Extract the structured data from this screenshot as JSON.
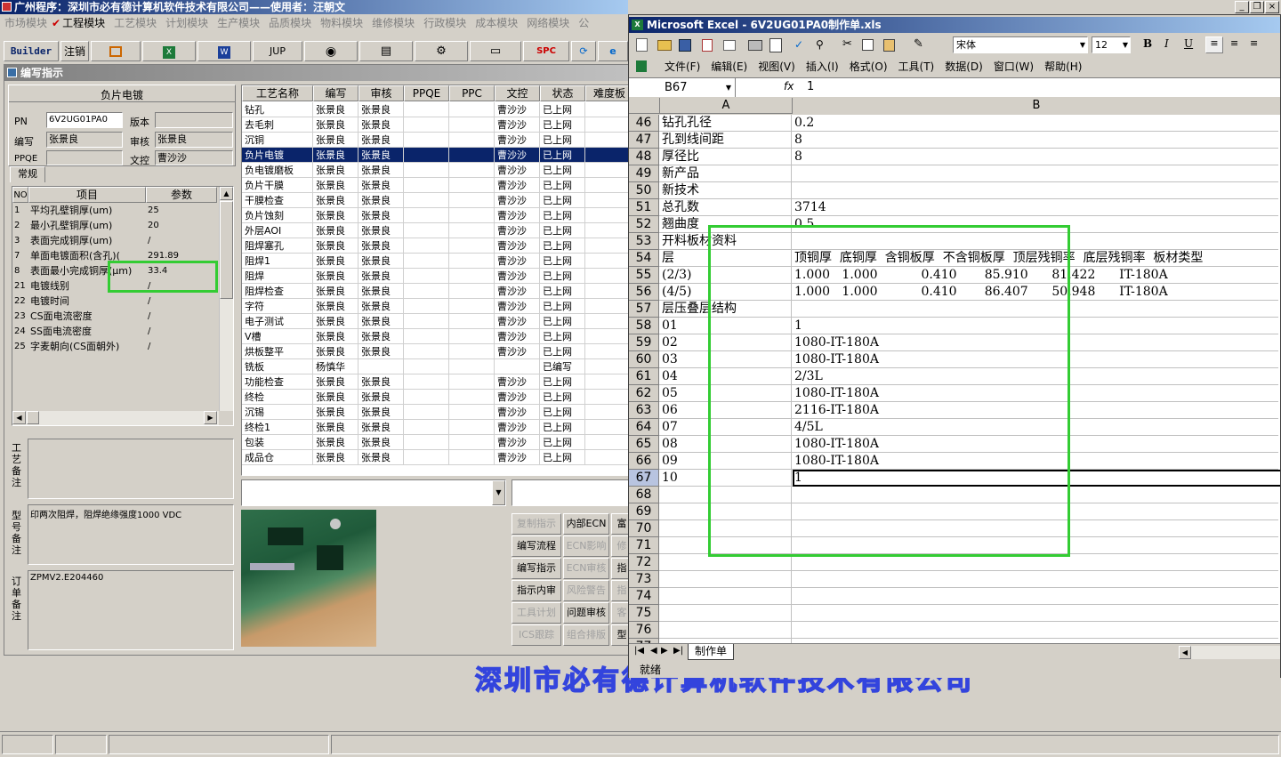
{
  "app": {
    "title": "广州程序：深圳市必有德计算机软件技术有限公司——使用者：汪朝文"
  },
  "menu": [
    "市场模块",
    "工程模块",
    "工艺模块",
    "计划模块",
    "生产模块",
    "品质模块",
    "物料模块",
    "维修模块",
    "行政模块",
    "成本模块",
    "网络模块",
    "公"
  ],
  "toolbar": {
    "builder": "Builder",
    "logout": "注销",
    "jup": "JUP",
    "spc": "SPC"
  },
  "panel": {
    "title": "编写指示",
    "section_title": "负片电镀",
    "pn_label": "PN",
    "pn_value": "6V2UG01PA0",
    "version_label": "版本",
    "version_value": "",
    "editor_label": "编写",
    "editor_value": "张景良",
    "reviewer_label": "审核",
    "reviewer_value": "张景良",
    "ppqe_label": "PPQE",
    "ppqe_value": "",
    "control_label": "文控",
    "control_value": "曹沙沙",
    "tab_general": "常规",
    "param_headers": [
      "NO",
      "项目",
      "参数"
    ],
    "params": [
      {
        "no": "1",
        "item": "平均孔壁铜厚(um)",
        "value": "25"
      },
      {
        "no": "2",
        "item": "最小孔壁铜厚(um)",
        "value": "20"
      },
      {
        "no": "3",
        "item": "表面完成铜厚(um)",
        "value": "/"
      },
      {
        "no": "7",
        "item": "单面电镀面积(含孔)(",
        "value": "291.89"
      },
      {
        "no": "8",
        "item": "表面最小完成铜厚(μm)",
        "value": "33.4"
      },
      {
        "no": "21",
        "item": "电镀线别",
        "value": "/"
      },
      {
        "no": "22",
        "item": "电镀时间",
        "value": "/"
      },
      {
        "no": "23",
        "item": "CS面电流密度",
        "value": "/"
      },
      {
        "no": "24",
        "item": "SS面电流密度",
        "value": "/"
      },
      {
        "no": "25",
        "item": "字麦朝向(CS面朝外)",
        "value": "/"
      }
    ],
    "craft_note_label": "工艺备注",
    "craft_note": "",
    "model_note_label": "型号备注",
    "model_note": "印两次阻焊，阻焊绝缘强度1000 VDC",
    "order_note_label": "订单备注",
    "order_note": "ZPMV2.E204460"
  },
  "process": {
    "headers": [
      "工艺名称",
      "编写",
      "审核",
      "PPQE",
      "PPC",
      "文控",
      "状态",
      "难度板"
    ],
    "rows": [
      [
        "钻孔",
        "张景良",
        "张景良",
        "",
        "",
        "曹沙沙",
        "已上网"
      ],
      [
        "去毛刺",
        "张景良",
        "张景良",
        "",
        "",
        "曹沙沙",
        "已上网"
      ],
      [
        "沉铜",
        "张景良",
        "张景良",
        "",
        "",
        "曹沙沙",
        "已上网"
      ],
      [
        "负片电镀",
        "张景良",
        "张景良",
        "",
        "",
        "曹沙沙",
        "已上网"
      ],
      [
        "负电镀磨板",
        "张景良",
        "张景良",
        "",
        "",
        "曹沙沙",
        "已上网"
      ],
      [
        "负片干膜",
        "张景良",
        "张景良",
        "",
        "",
        "曹沙沙",
        "已上网"
      ],
      [
        "干膜检查",
        "张景良",
        "张景良",
        "",
        "",
        "曹沙沙",
        "已上网"
      ],
      [
        "负片蚀刻",
        "张景良",
        "张景良",
        "",
        "",
        "曹沙沙",
        "已上网"
      ],
      [
        "外层AOI",
        "张景良",
        "张景良",
        "",
        "",
        "曹沙沙",
        "已上网"
      ],
      [
        "阻焊塞孔",
        "张景良",
        "张景良",
        "",
        "",
        "曹沙沙",
        "已上网"
      ],
      [
        "阻焊1",
        "张景良",
        "张景良",
        "",
        "",
        "曹沙沙",
        "已上网"
      ],
      [
        "阻焊",
        "张景良",
        "张景良",
        "",
        "",
        "曹沙沙",
        "已上网"
      ],
      [
        "阻焊检查",
        "张景良",
        "张景良",
        "",
        "",
        "曹沙沙",
        "已上网"
      ],
      [
        "字符",
        "张景良",
        "张景良",
        "",
        "",
        "曹沙沙",
        "已上网"
      ],
      [
        "电子测试",
        "张景良",
        "张景良",
        "",
        "",
        "曹沙沙",
        "已上网"
      ],
      [
        "V槽",
        "张景良",
        "张景良",
        "",
        "",
        "曹沙沙",
        "已上网"
      ],
      [
        "烘板整平",
        "张景良",
        "张景良",
        "",
        "",
        "曹沙沙",
        "已上网"
      ],
      [
        "铣板",
        "杨慎华",
        "",
        "",
        "",
        "",
        "已编写"
      ],
      [
        "功能检查",
        "张景良",
        "张景良",
        "",
        "",
        "曹沙沙",
        "已上网"
      ],
      [
        "终检",
        "张景良",
        "张景良",
        "",
        "",
        "曹沙沙",
        "已上网"
      ],
      [
        "沉锡",
        "张景良",
        "张景良",
        "",
        "",
        "曹沙沙",
        "已上网"
      ],
      [
        "终检1",
        "张景良",
        "张景良",
        "",
        "",
        "曹沙沙",
        "已上网"
      ],
      [
        "包装",
        "张景良",
        "张景良",
        "",
        "",
        "曹沙沙",
        "已上网"
      ],
      [
        "成品仓",
        "张景良",
        "张景良",
        "",
        "",
        "曹沙沙",
        "已上网"
      ]
    ]
  },
  "actions": [
    [
      "复制指示",
      "内部ECN",
      "富"
    ],
    [
      "编写流程",
      "ECN影响",
      "修"
    ],
    [
      "编写指示",
      "ECN审核",
      "指"
    ],
    [
      "指示内审",
      "风险警告",
      "指"
    ],
    [
      "工具计划",
      "问题审核",
      "客"
    ],
    [
      "ICS跟踪",
      "组合排版",
      "型"
    ]
  ],
  "watermark": "深圳市必有德计算机软件技术有限公司",
  "excel": {
    "title": "Microsoft Excel - 6V2UG01PA0制作单.xls",
    "font": "宋体",
    "font_size": "12",
    "menu": [
      "文件(F)",
      "编辑(E)",
      "视图(V)",
      "插入(I)",
      "格式(O)",
      "工具(T)",
      "数据(D)",
      "窗口(W)",
      "帮助(H)"
    ],
    "namebox": "B67",
    "fx": "fx",
    "formula": "1",
    "col_a": "A",
    "col_b": "B",
    "rows": [
      {
        "n": "46",
        "a": "钻孔孔径",
        "b": "0.2"
      },
      {
        "n": "47",
        "a": "孔到线间距",
        "b": "8"
      },
      {
        "n": "48",
        "a": "厚径比",
        "b": "8"
      },
      {
        "n": "49",
        "a": "新产品",
        "b": ""
      },
      {
        "n": "50",
        "a": "新技术",
        "b": ""
      },
      {
        "n": "51",
        "a": "总孔数",
        "b": "3714"
      },
      {
        "n": "52",
        "a": "翘曲度",
        "b": "0.5"
      },
      {
        "n": "53",
        "a": "开料板材资料",
        "b": ""
      },
      {
        "n": "54",
        "a": "层",
        "b": "顶铜厚  底铜厚  含铜板厚  不含铜板厚  顶层残铜率  底层残铜率  板材类型"
      },
      {
        "n": "55",
        "a": "(2/3)",
        "b": "1.000   1.000           0.410       85.910      81.422      IT-180A"
      },
      {
        "n": "56",
        "a": "(4/5)",
        "b": "1.000   1.000           0.410       86.407      50.948      IT-180A"
      },
      {
        "n": "57",
        "a": "层压叠层结构",
        "b": ""
      },
      {
        "n": "58",
        "a": "01",
        "b": "1"
      },
      {
        "n": "59",
        "a": "02",
        "b": "1080-IT-180A"
      },
      {
        "n": "60",
        "a": "03",
        "b": "1080-IT-180A"
      },
      {
        "n": "61",
        "a": "04",
        "b": "2/3L"
      },
      {
        "n": "62",
        "a": "05",
        "b": "1080-IT-180A"
      },
      {
        "n": "63",
        "a": "06",
        "b": "2116-IT-180A"
      },
      {
        "n": "64",
        "a": "07",
        "b": "4/5L"
      },
      {
        "n": "65",
        "a": "08",
        "b": "1080-IT-180A"
      },
      {
        "n": "66",
        "a": "09",
        "b": "1080-IT-180A"
      },
      {
        "n": "67",
        "a": "10",
        "b": "1"
      },
      {
        "n": "68",
        "a": "",
        "b": ""
      },
      {
        "n": "69",
        "a": "",
        "b": ""
      },
      {
        "n": "70",
        "a": "",
        "b": ""
      },
      {
        "n": "71",
        "a": "",
        "b": ""
      },
      {
        "n": "72",
        "a": "",
        "b": ""
      },
      {
        "n": "73",
        "a": "",
        "b": ""
      },
      {
        "n": "74",
        "a": "",
        "b": ""
      },
      {
        "n": "75",
        "a": "",
        "b": ""
      },
      {
        "n": "76",
        "a": "",
        "b": ""
      },
      {
        "n": "77",
        "a": "",
        "b": ""
      }
    ],
    "sheet_tab": "制作单",
    "status": "就绪"
  },
  "colors": {
    "titlebar": "#0a246a",
    "selection": "#0a246a",
    "highlight": "#33cc33"
  }
}
